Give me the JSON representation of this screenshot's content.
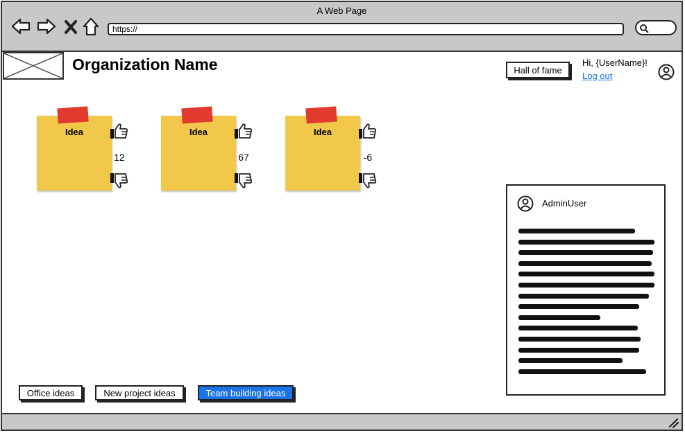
{
  "browser": {
    "title": "A Web Page",
    "url": "https://"
  },
  "header": {
    "org_name": "Organization Name",
    "hall_of_fame_label": "Hall of fame",
    "greeting": "Hi, {UserName}!",
    "logout_label": "Log out"
  },
  "ideas": [
    {
      "label": "Idea",
      "votes": "12"
    },
    {
      "label": "Idea",
      "votes": "67"
    },
    {
      "label": "Idea",
      "votes": "-6"
    }
  ],
  "categories": [
    {
      "label": "Office ideas",
      "active": false
    },
    {
      "label": "New project ideas",
      "active": false
    },
    {
      "label": "Team building ideas",
      "active": true
    }
  ],
  "admin_card": {
    "name": "AdminUser"
  },
  "icons": {
    "back": "back-arrow-icon",
    "forward": "forward-arrow-icon",
    "close": "close-x-icon",
    "home": "home-icon",
    "search": "search-icon",
    "user": "user-circle-icon",
    "thumbs_up": "thumbs-up-icon",
    "thumbs_down": "thumbs-down-icon",
    "resize": "resize-grip-icon"
  },
  "colors": {
    "frame_gray": "#c8c8c8",
    "note_yellow": "#f2c84b",
    "tape_red": "#e03b2e",
    "link_blue": "#1a73e8",
    "active_tab_blue": "#1a73e8"
  }
}
